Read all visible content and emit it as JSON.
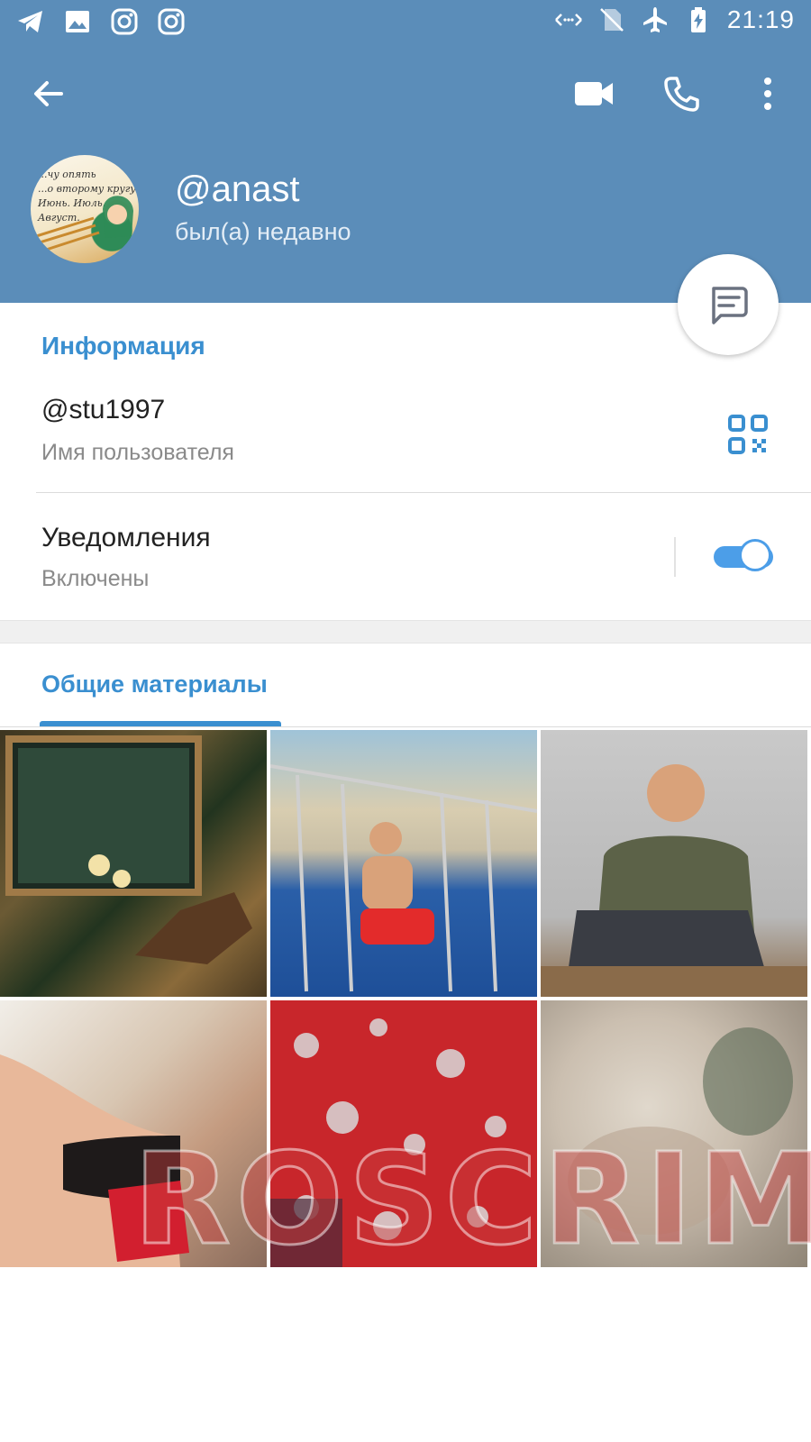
{
  "status_bar": {
    "time": "21:19",
    "left_icons": [
      "telegram-icon",
      "gallery-icon",
      "instagram-icon",
      "instagram-icon"
    ],
    "right_icons": [
      "data-arrows-icon",
      "no-sim-icon",
      "airplane-icon",
      "battery-charging-icon"
    ]
  },
  "toolbar": {
    "back_icon": "arrow-left-icon",
    "video_call_icon": "video-camera-icon",
    "call_icon": "phone-icon",
    "more_icon": "more-vertical-icon"
  },
  "profile": {
    "name": "@anast",
    "last_seen": "был(а) недавно",
    "avatar_text": [
      "...чу опять",
      "...о второму кругу",
      "Июнь. Июль.",
      "Август."
    ]
  },
  "info": {
    "section_title": "Информация",
    "username_value": "@stu1997",
    "username_label": "Имя пользователя",
    "notifications_title": "Уведомления",
    "notifications_status": "Включены",
    "notifications_enabled": true
  },
  "shared_media": {
    "title": "Общие материалы",
    "watermark": "ROSCRIME"
  },
  "colors": {
    "header": "#5b8db9",
    "accent": "#3a8fd0",
    "toggle": "#4c9ee8"
  }
}
